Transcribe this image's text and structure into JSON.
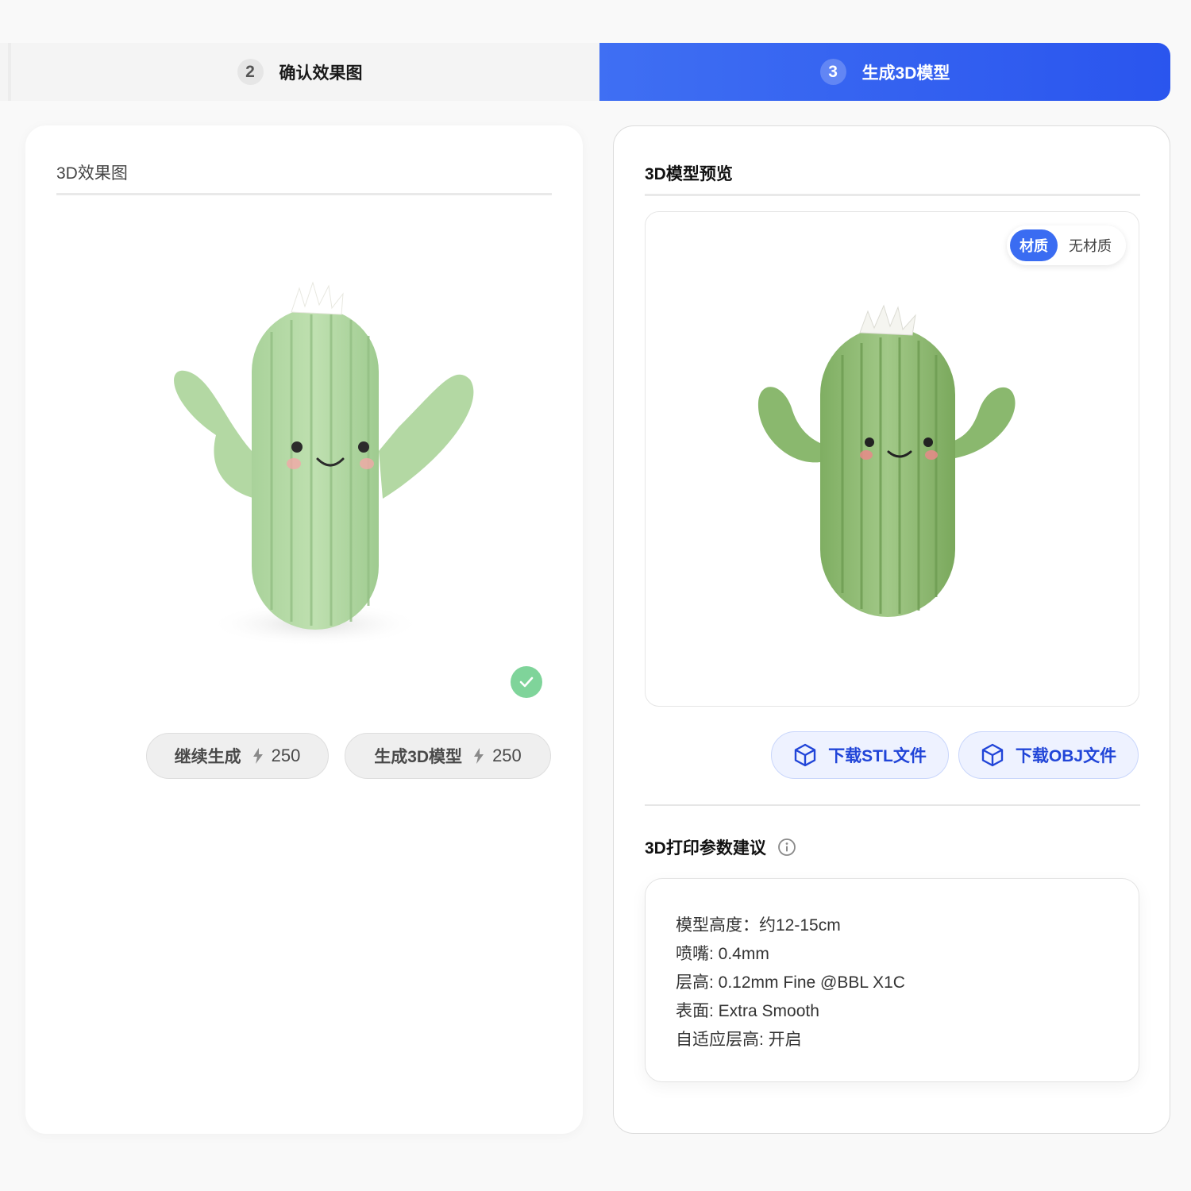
{
  "steps": [
    {
      "number": "2",
      "label": "确认效果图",
      "state": "done"
    },
    {
      "number": "3",
      "label": "生成3D模型",
      "state": "active"
    }
  ],
  "colors": {
    "accent": "#3a6cf2",
    "active_step_gradient": [
      "#3f6ff3",
      "#2a55ee"
    ],
    "success": "#7fd49a",
    "download_text": "#2145d8"
  },
  "left_panel": {
    "title": "3D效果图",
    "image_alt": "cactus plush render",
    "selected_icon": "check-icon",
    "buttons": [
      {
        "label": "继续生成",
        "icon": "bolt-icon",
        "cost": "250"
      },
      {
        "label": "生成3D模型",
        "icon": "bolt-icon",
        "cost": "250"
      }
    ]
  },
  "right_panel": {
    "title": "3D模型预览",
    "material_toggle": {
      "options": [
        "材质",
        "无材质"
      ],
      "selected": "材质"
    },
    "downloads": [
      {
        "label": "下载STL文件",
        "icon": "cube-icon"
      },
      {
        "label": "下载OBJ文件",
        "icon": "cube-icon"
      }
    ],
    "print_params": {
      "title": "3D打印参数建议",
      "icon": "info-icon",
      "lines": [
        "模型高度：约12-15cm",
        "喷嘴: 0.4mm",
        "层高: 0.12mm Fine @BBL X1C",
        "表面: Extra Smooth",
        "自适应层高: 开启"
      ]
    }
  }
}
